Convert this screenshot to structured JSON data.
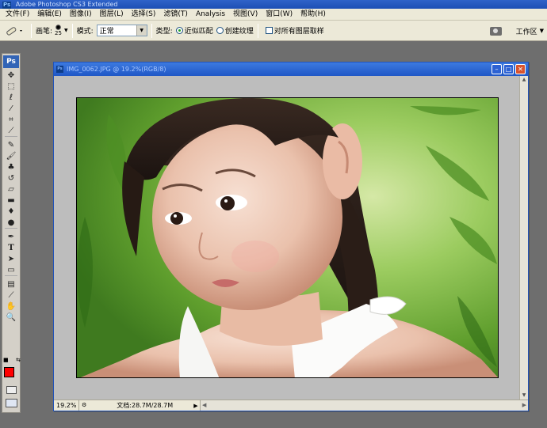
{
  "app_title": "Adobe Photoshop CS3 Extended",
  "menu": [
    "文件(F)",
    "编辑(E)",
    "图像(I)",
    "图层(L)",
    "选择(S)",
    "滤镜(T)",
    "Analysis",
    "视图(V)",
    "窗口(W)",
    "帮助(H)"
  ],
  "options": {
    "brush_label": "画笔:",
    "brush_size": "25",
    "mode_label": "模式:",
    "mode_value": "正常",
    "type_label": "类型:",
    "type_option_1": "近似匹配",
    "type_option_2": "创建纹理",
    "sample_all_label": "对所有图层取样",
    "workspace_label": "工作区"
  },
  "toolbox": {
    "logo": "Ps",
    "tools": [
      "move-icon",
      "marquee-icon",
      "lasso-icon",
      "magic-wand-icon",
      "crop-icon",
      "slice-icon",
      "spot-healing-icon",
      "brush-icon",
      "clone-stamp-icon",
      "history-brush-icon",
      "eraser-icon",
      "gradient-icon",
      "blur-icon",
      "dodge-icon",
      "pen-icon",
      "type-icon",
      "path-selection-icon",
      "shape-icon",
      "notes-icon",
      "eyedropper-icon",
      "hand-icon",
      "zoom-icon"
    ],
    "foreground_color": "#ff0000",
    "background_color": "#ffffff"
  },
  "document": {
    "title": "IMG_0062.JPG @ 19.2%(RGB/8)",
    "zoom": "19.2%",
    "doc_info": "文档:28.7M/28.7M"
  }
}
